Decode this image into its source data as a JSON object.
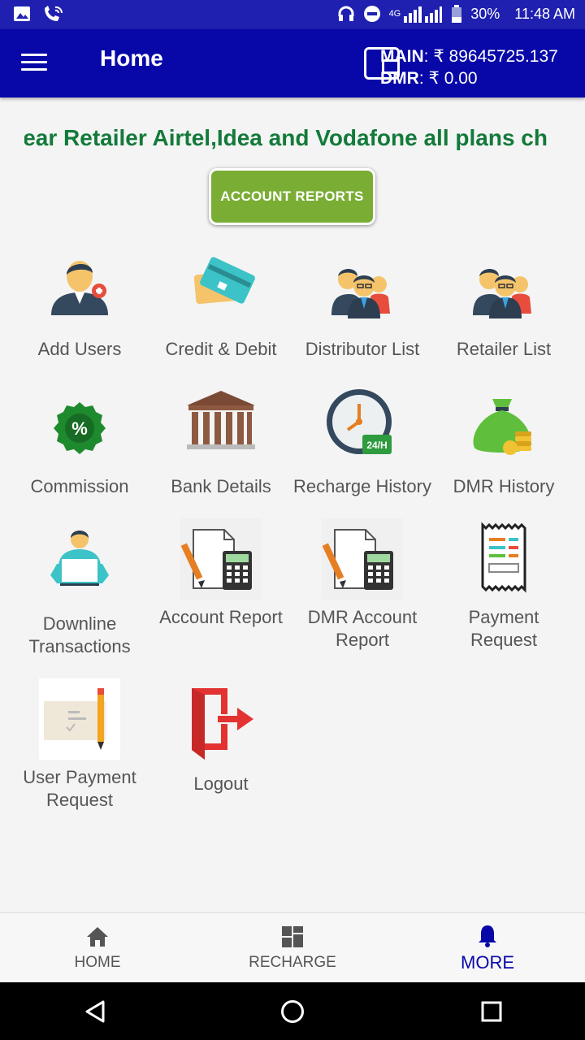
{
  "status_bar": {
    "battery": "30%",
    "time": "11:48 AM",
    "network": "4G"
  },
  "app_bar": {
    "title": "Home",
    "main_label": "MAIN",
    "main_value": ": ₹ 89645725.137",
    "dmr_label": "DMR",
    "dmr_value": ": ₹ 0.00"
  },
  "marquee": {
    "text": "Dear Retailer  Airtel,Idea and Vodafone all plans ch"
  },
  "account_reports_button": "ACCOUNT REPORTS",
  "grid": [
    {
      "label": "Add Users",
      "icon": "add-user-icon"
    },
    {
      "label": "Credit & Debit",
      "icon": "credit-card-icon"
    },
    {
      "label": "Distributor List",
      "icon": "group-icon"
    },
    {
      "label": "Retailer List",
      "icon": "group-icon"
    },
    {
      "label": "Commission",
      "icon": "percent-badge-icon"
    },
    {
      "label": "Bank Details",
      "icon": "bank-icon"
    },
    {
      "label": "Recharge History",
      "icon": "clock-24h-icon"
    },
    {
      "label": "DMR History",
      "icon": "money-bag-icon"
    },
    {
      "label": "Downline Transactions",
      "icon": "person-laptop-icon"
    },
    {
      "label": "Account Report",
      "icon": "calculator-report-icon"
    },
    {
      "label": "DMR Account Report",
      "icon": "calculator-report-icon"
    },
    {
      "label": "Payment Request",
      "icon": "receipt-icon"
    },
    {
      "label": "User Payment Request",
      "icon": "cheque-icon"
    },
    {
      "label": "Logout",
      "icon": "logout-icon"
    }
  ],
  "bottom_nav": {
    "home": "HOME",
    "recharge": "RECHARGE",
    "more": "MORE"
  },
  "colors": {
    "app_bar": "#0808a8",
    "status_bar": "#1f20b0",
    "marquee_text": "#137a3a",
    "button": "#7aad34"
  }
}
